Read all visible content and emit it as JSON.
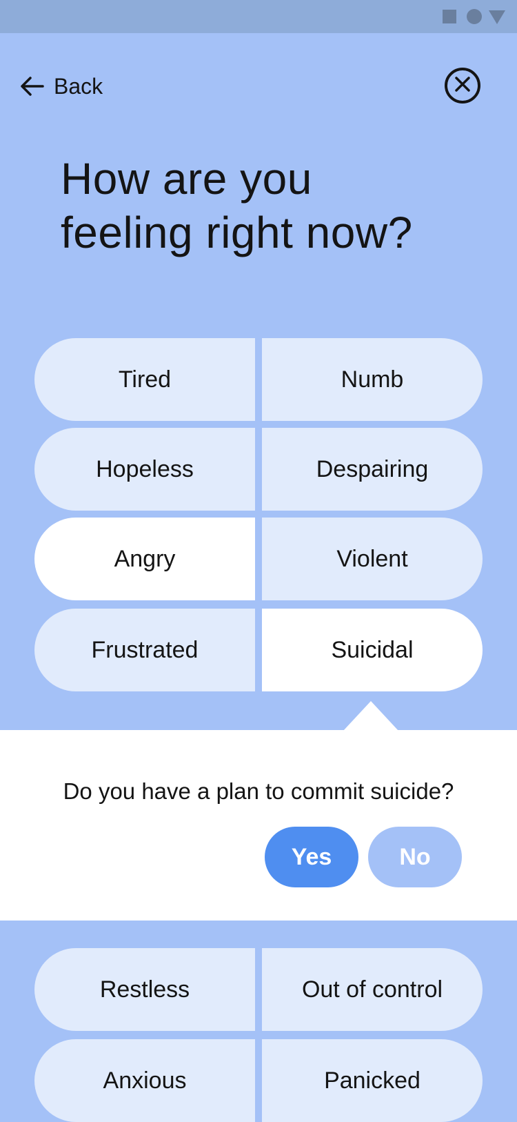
{
  "statusbar": {
    "icons": [
      "stop-square-icon",
      "record-circle-icon",
      "signal-triangle-icon"
    ],
    "color": "#6a7f9e",
    "background": "#8eacd9"
  },
  "nav": {
    "back_label": "Back",
    "back_icon": "arrow-left-icon",
    "close_icon": "close-circle-icon"
  },
  "title": {
    "line1": "How are you",
    "line2": "feeling right now?"
  },
  "feelings": [
    {
      "label": "Tired",
      "selected": false
    },
    {
      "label": "Numb",
      "selected": false
    },
    {
      "label": "Hopeless",
      "selected": false
    },
    {
      "label": "Despairing",
      "selected": false
    },
    {
      "label": "Angry",
      "selected": true
    },
    {
      "label": "Violent",
      "selected": false
    },
    {
      "label": "Frustrated",
      "selected": false
    },
    {
      "label": "Suicidal",
      "selected": true
    },
    {
      "label": "Restless",
      "selected": false
    },
    {
      "label": "Out of control",
      "selected": false
    },
    {
      "label": "Anxious",
      "selected": false
    },
    {
      "label": "Panicked",
      "selected": false
    }
  ],
  "followup": {
    "question": "Do you have a plan to commit suicide?",
    "yes_label": "Yes",
    "no_label": "No"
  },
  "colors": {
    "background": "#a4c1f7",
    "pill": "#e1ebfc",
    "pill_selected": "#ffffff",
    "yes_button": "#4f8ef0",
    "no_button": "#a4c1f7",
    "text": "#141414"
  }
}
